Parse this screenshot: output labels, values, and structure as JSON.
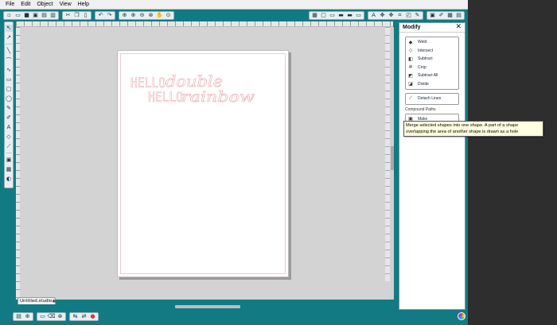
{
  "menu": [
    "File",
    "Edit",
    "Object",
    "View",
    "Help"
  ],
  "toolbar": {
    "group1": [
      "new-icon",
      "open-icon",
      "save-icon",
      "save-as-icon",
      "library-icon",
      "print-icon"
    ],
    "group2": [
      "cut-icon",
      "copy-icon",
      "paste-icon"
    ],
    "group3": [
      "undo-icon",
      "redo-icon"
    ],
    "group4": [
      "select-icon",
      "zoom-in-icon",
      "zoom-out-icon",
      "zoom-fit-icon",
      "pan-icon",
      "zoom-page-icon"
    ],
    "group5": [
      "grid-icon",
      "page-setup-icon",
      "page-icon",
      "fill-icon",
      "line-color-icon",
      "line-style-icon"
    ],
    "group6": [
      "text-style-icon",
      "transform-icon",
      "replicate-icon",
      "modify-icon",
      "offset-icon",
      "trace-icon"
    ],
    "group7": [
      "send-icon",
      "store-icon",
      "library-panel-icon",
      "design-store-icon"
    ]
  },
  "left_tools": [
    "select-tool-icon",
    "edit-points-icon",
    "line-icon",
    "polygon-icon",
    "curve-icon",
    "rectangle-icon",
    "rounded-rect-icon",
    "ellipse-icon",
    "freehand-icon",
    "smooth-freehand-icon",
    "text-icon",
    "eraser-icon",
    "knife-icon",
    "zoom-tool-icon",
    "group-icon",
    "ungroup-icon",
    "fill-tool-icon"
  ],
  "document": {
    "tab_label": "Untitled.studio",
    "close_glyph": "✱",
    "artwork": {
      "line1_a": "HELLO",
      "line1_b": "double",
      "line2_a": "HELLO",
      "line2_b": "rainbow",
      "stroke_color": "#e9a6ad"
    }
  },
  "panel": {
    "title": "Modify",
    "close_glyph": "✕",
    "items": [
      {
        "label": "Weld",
        "icon": "weld-icon"
      },
      {
        "label": "Intersect",
        "icon": "intersect-icon"
      },
      {
        "label": "Subtract",
        "icon": "subtract-icon"
      },
      {
        "label": "Crop",
        "icon": "crop-icon"
      },
      {
        "label": "Subtract All",
        "icon": "subtract-all-icon"
      },
      {
        "label": "Divide",
        "icon": "divide-icon"
      }
    ],
    "detach": {
      "label": "Detach Lines",
      "icon": "detach-lines-icon"
    },
    "compound_section": "Compound Paths",
    "make": {
      "label": "Make",
      "icon": "make-compound-icon"
    }
  },
  "tooltip": "Merge selected shapes into one shape. A part of a shape overlapping the area of another shape is drawn as a hole",
  "bottom_tools": [
    "layers-icon",
    "zoom-icon",
    "nav-icon",
    "settings-icon",
    "cut-settings-icon",
    "send-icon",
    "extra-icon",
    "color-icon"
  ],
  "colors": {
    "app_teal": "#127a83",
    "canvas_gray": "#d3d3d3",
    "artwork_pink": "#e9a6ad"
  }
}
